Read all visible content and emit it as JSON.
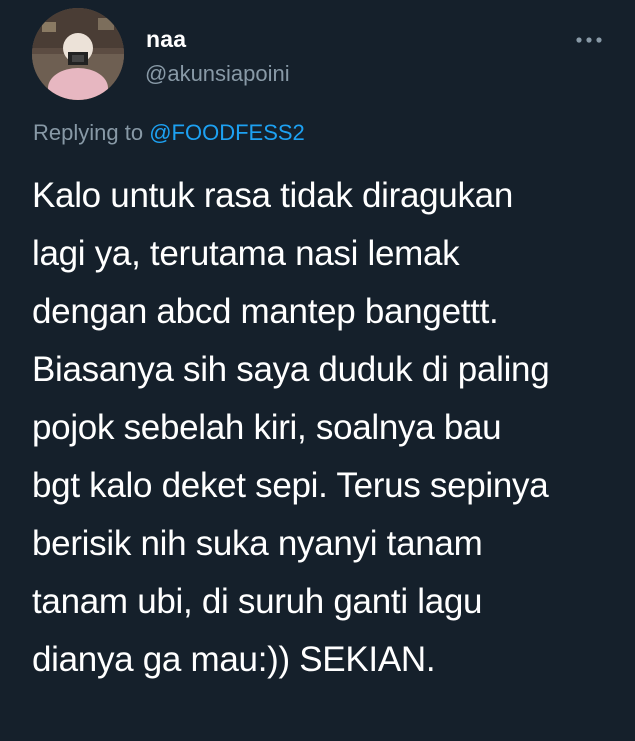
{
  "tweet": {
    "author": {
      "display_name": "naa",
      "handle": "@akunsiapoini"
    },
    "more_icon": "more-horizontal-icon",
    "replying_to": {
      "prefix": "Replying to",
      "mention": "@FOODFESS2"
    },
    "text_lines": [
      "Kalo untuk rasa tidak diragukan",
      "lagi ya, terutama nasi lemak",
      "dengan abcd mantep bangettt.",
      "Biasanya sih saya duduk di paling",
      "pojok sebelah kiri, soalnya bau",
      "bgt kalo deket sepi. Terus sepinya",
      "berisik nih suka nyanyi tanam",
      "tanam ubi, di suruh ganti lagu",
      "dianya ga mau:)) SEKIAN."
    ]
  },
  "colors": {
    "background": "#15202b",
    "primary_text": "#ffffff",
    "secondary_text": "#8899a6",
    "link": "#1da1f2"
  }
}
